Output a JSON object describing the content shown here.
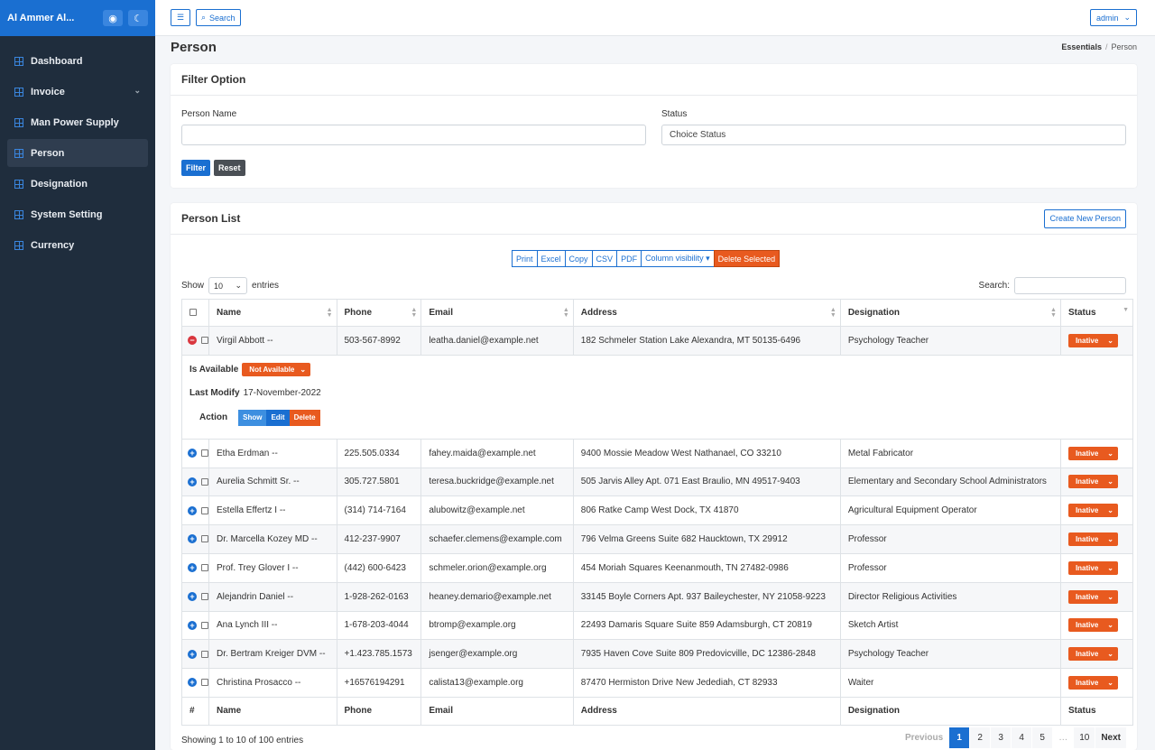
{
  "brand": {
    "name": "Al Ammer Al...",
    "eye_icon": "eye-icon",
    "moon_icon": "moon-icon"
  },
  "sidebar": {
    "items": [
      {
        "label": "Dashboard",
        "icon": "grid-icon",
        "active": false
      },
      {
        "label": "Invoice",
        "icon": "grid-icon",
        "active": false,
        "has_children": true
      },
      {
        "label": "Man Power Supply",
        "icon": "grid-icon",
        "active": false
      },
      {
        "label": "Person",
        "icon": "grid-icon",
        "active": true
      },
      {
        "label": "Designation",
        "icon": "grid-icon",
        "active": false
      },
      {
        "label": "System Setting",
        "icon": "grid-icon",
        "active": false
      },
      {
        "label": "Currency",
        "icon": "grid-icon",
        "active": false
      }
    ]
  },
  "topbar": {
    "menu_icon": "☰",
    "search_label": "Search",
    "user_label": "admin"
  },
  "page": {
    "title": "Person",
    "breadcrumb": [
      "Essentials",
      "Person"
    ]
  },
  "filter": {
    "title": "Filter Option",
    "person_name_label": "Person Name",
    "person_name_value": "",
    "status_label": "Status",
    "status_value": "Choice Status",
    "filter_btn": "Filter",
    "reset_btn": "Reset"
  },
  "list": {
    "title": "Person List",
    "create_btn": "Create New Person",
    "buttons": [
      "Print",
      "Excel",
      "Copy",
      "CSV",
      "PDF",
      "Column visibility ▾",
      "Delete Selected"
    ],
    "show_label": "Show",
    "page_size": "10",
    "entries_label": "entries",
    "search_label": "Search:",
    "columns": [
      "Name",
      "Phone",
      "Email",
      "Address",
      "Designation",
      "Status"
    ],
    "footer_columns": [
      "#",
      "Name",
      "Phone",
      "Email",
      "Address",
      "Designation",
      "Status"
    ],
    "rows": [
      {
        "name": "Virgil Abbott --",
        "phone": "503-567-8992",
        "email": "leatha.daniel@example.net",
        "address": "182 Schmeler Station Lake Alexandra, MT 50135-6496",
        "designation": "Psychology Teacher",
        "status": "Inative"
      },
      {
        "name": "Etha Erdman --",
        "phone": "225.505.0334",
        "email": "fahey.maida@example.net",
        "address": "9400 Mossie Meadow West Nathanael, CO 33210",
        "designation": "Metal Fabricator",
        "status": "Inative"
      },
      {
        "name": "Aurelia Schmitt Sr. --",
        "phone": "305.727.5801",
        "email": "teresa.buckridge@example.net",
        "address": "505 Jarvis Alley Apt. 071 East Braulio, MN 49517-9403",
        "designation": "Elementary and Secondary School Administrators",
        "status": "Inative"
      },
      {
        "name": "Estella Effertz I --",
        "phone": "(314) 714-7164",
        "email": "alubowitz@example.net",
        "address": "806 Ratke Camp West Dock, TX 41870",
        "designation": "Agricultural Equipment Operator",
        "status": "Inative"
      },
      {
        "name": "Dr. Marcella Kozey MD --",
        "phone": "412-237-9907",
        "email": "schaefer.clemens@example.com",
        "address": "796 Velma Greens Suite 682 Haucktown, TX 29912",
        "designation": "Professor",
        "status": "Inative"
      },
      {
        "name": "Prof. Trey Glover I --",
        "phone": "(442) 600-6423",
        "email": "schmeler.orion@example.org",
        "address": "454 Moriah Squares Keenanmouth, TN 27482-0986",
        "designation": "Professor",
        "status": "Inative"
      },
      {
        "name": "Alejandrin Daniel --",
        "phone": "1-928-262-0163",
        "email": "heaney.demario@example.net",
        "address": "33145 Boyle Corners Apt. 937 Baileychester, NY 21058-9223",
        "designation": "Director Religious Activities",
        "status": "Inative"
      },
      {
        "name": "Ana Lynch III --",
        "phone": "1-678-203-4044",
        "email": "btromp@example.org",
        "address": "22493 Damaris Square Suite 859 Adamsburgh, CT 20819",
        "designation": "Sketch Artist",
        "status": "Inative"
      },
      {
        "name": "Dr. Bertram Kreiger DVM --",
        "phone": "+1.423.785.1573",
        "email": "jsenger@example.org",
        "address": "7935 Haven Cove Suite 809 Predovicville, DC 12386-2848",
        "designation": "Psychology Teacher",
        "status": "Inative"
      },
      {
        "name": "Christina Prosacco --",
        "phone": "+16576194291",
        "email": "calista13@example.org",
        "address": "87470 Hermiston Drive New Jedediah, CT 82933",
        "designation": "Waiter",
        "status": "Inative"
      }
    ],
    "detail": {
      "available_label": "Is Available",
      "available_value": "Not Available",
      "modify_label": "Last Modify",
      "modify_value": "17-November-2022",
      "action_label": "Action",
      "show_btn": "Show",
      "edit_btn": "Edit",
      "delete_btn": "Delete"
    },
    "info": "Showing 1 to 10 of 100 entries",
    "pagination": [
      "Previous",
      "1",
      "2",
      "3",
      "4",
      "5",
      "…",
      "10",
      "Next"
    ]
  },
  "colors": {
    "primary": "#1a6fd1",
    "danger": "#e85a1f",
    "sidebar": "#1f2d3d",
    "show_btn": "#3d8fe0",
    "dark_btn": "#4a4f55"
  }
}
